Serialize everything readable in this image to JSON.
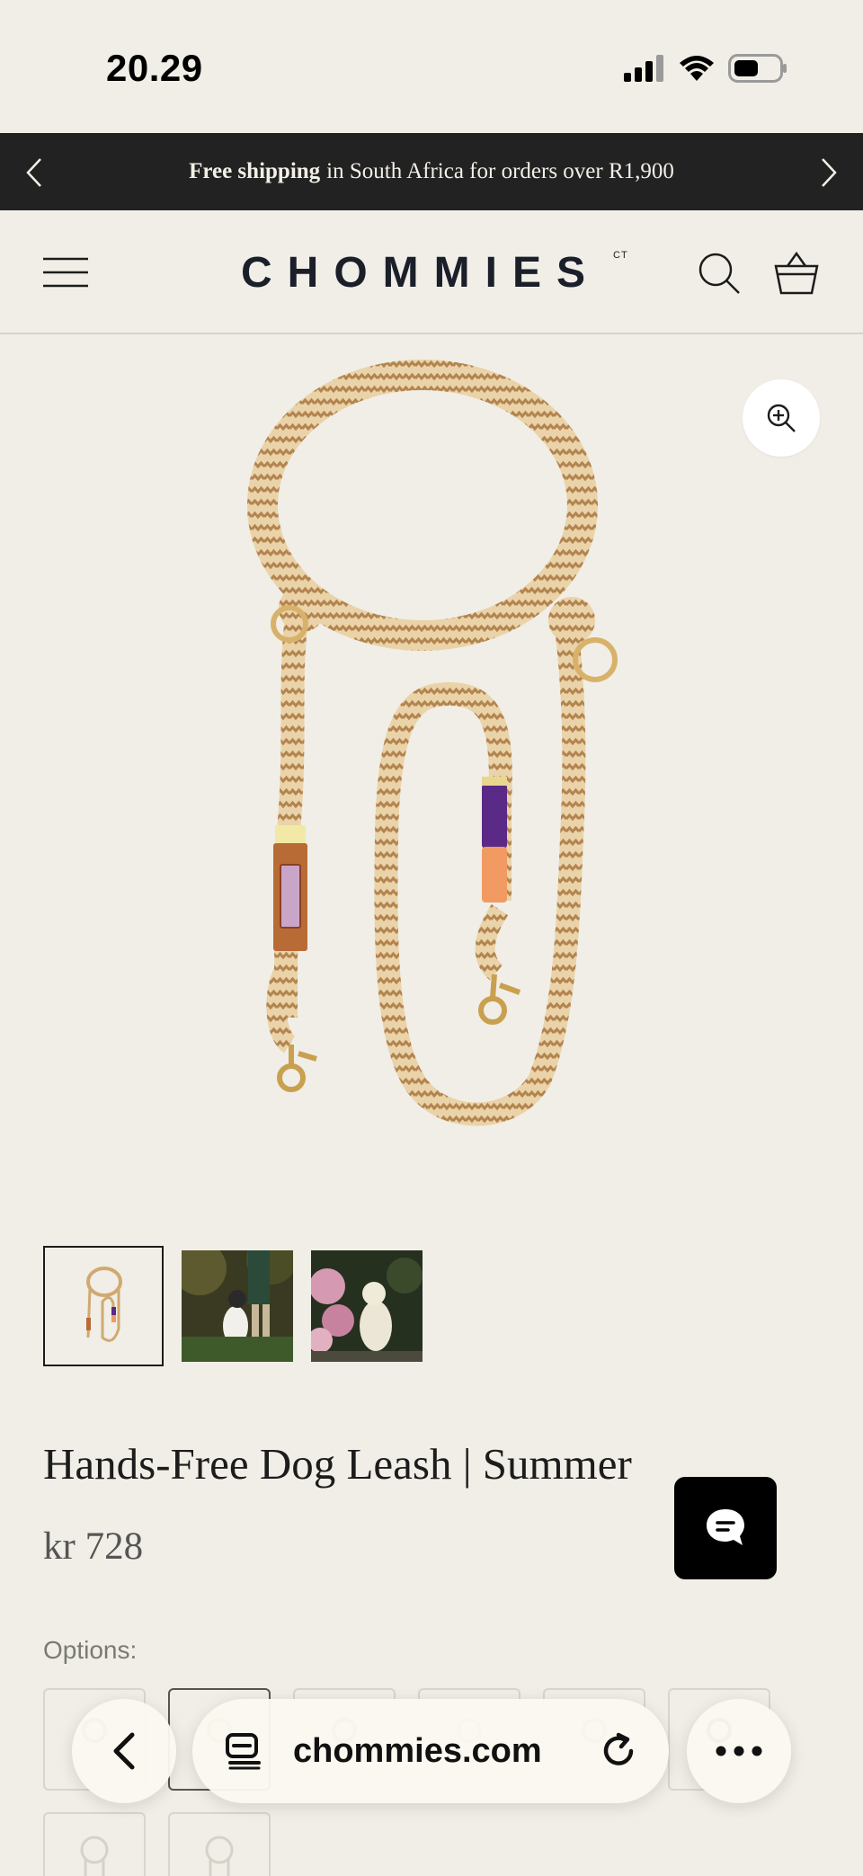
{
  "status_bar": {
    "time": "20.29"
  },
  "announcement": {
    "bold_text": "Free shipping",
    "text": "in South Africa for orders over R1,900"
  },
  "header": {
    "logo": "CHOMMIES",
    "logo_suffix": "CT"
  },
  "product": {
    "title": "Hands-Free Dog Leash | Summer",
    "price": "kr 728",
    "options_label": "Options:"
  },
  "browser": {
    "url": "chommies.com"
  },
  "colors": {
    "background": "#f0eee6",
    "announcement_bar": "#222222",
    "rope_light": "#e9d2a8",
    "rope_dark": "#b88a56",
    "purple_wrap": "#5a2a86",
    "orange_wrap": "#f19a62",
    "leather": "#b96b35"
  },
  "icons": [
    "chevron-left-icon",
    "chevron-right-icon",
    "hamburger-menu-icon",
    "search-icon",
    "basket-icon",
    "zoom-in-icon",
    "chat-icon",
    "back-arrow-icon",
    "tabs-icon",
    "reload-icon",
    "more-icon"
  ]
}
